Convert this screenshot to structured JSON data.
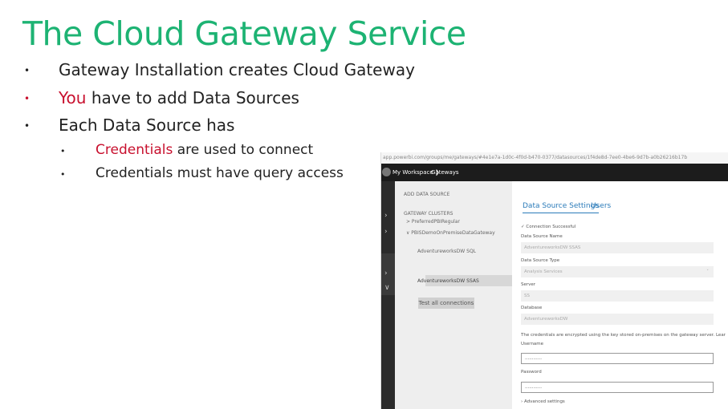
{
  "slide": {
    "title": "The Cloud Gateway Service",
    "bullets": [
      {
        "lead": "",
        "text": "Gateway Installation creates Cloud Gateway"
      },
      {
        "lead": "You",
        "text": " have to add Data Sources"
      },
      {
        "lead": "",
        "text": "Each Data Source has"
      }
    ],
    "sub_bullets": [
      {
        "lead": "Credentials",
        "text": " are used to connect"
      },
      {
        "lead": "",
        "text": "Credentials must have query access"
      }
    ],
    "bullet_glyph": "•",
    "accent_color": "#1db373",
    "highlight_color": "#c8102e"
  },
  "screenshot": {
    "url": "app.powerbi.com/groups/me/gateways/#4e1e7a-1d0c-4f0d-b470-0377/datasources/1f4de8d-7ee0-4be6-9d7b-a0b26216b17b",
    "breadcrumb": {
      "workspace": "My Workspace",
      "separator": "❯",
      "page": "Gateways"
    },
    "sidebar": {
      "add_data_source": "ADD DATA SOURCE",
      "gateway_clusters": "GATEWAY CLUSTERS",
      "clusters": [
        {
          "label": "> PreferredPBIRegular"
        },
        {
          "label": "∨ PBISDemoOnPremiseDataGateway"
        }
      ],
      "data_sources": [
        {
          "label": "AdventureworksDW SQL"
        },
        {
          "label": "AdventureworksDW SSAS"
        }
      ],
      "test_button": "Test all connections"
    },
    "tabs": {
      "active": "Data Source Settings",
      "other": "Users"
    },
    "form": {
      "status": "✓ Connection Successful",
      "data_source_name_label": "Data Source Name",
      "data_source_name_value": "AdventureworksDW SSAS",
      "data_source_type_label": "Data Source Type",
      "data_source_type_value": "Analysis Services",
      "server_label": "Server",
      "server_value": "SS",
      "database_label": "Database",
      "database_value": "AdventureworksDW",
      "note": "The credentials are encrypted using the key stored on-premises on the gateway server. Learn more",
      "username_label": "Username",
      "username_value": "············",
      "password_label": "Password",
      "password_value": "············",
      "advanced": "› Advanced settings"
    }
  }
}
